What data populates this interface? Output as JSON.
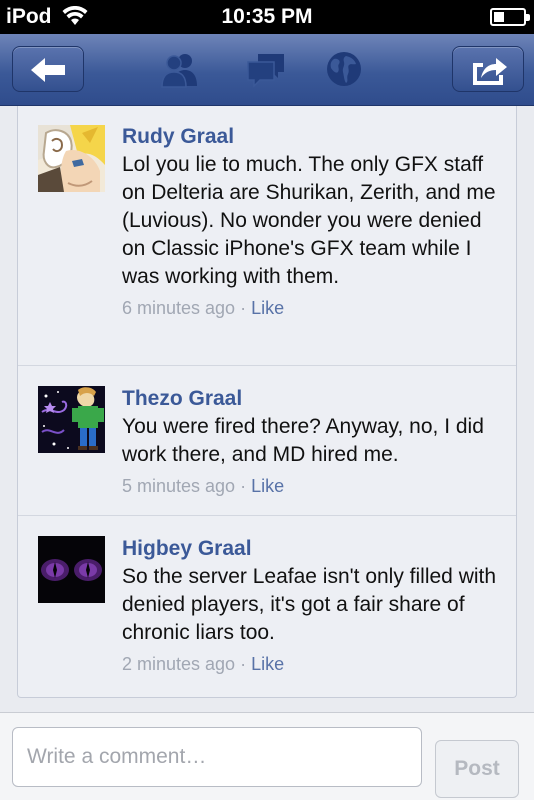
{
  "status_bar": {
    "carrier": "iPod",
    "time": "10:35 PM"
  },
  "nav": {
    "icons": [
      "back-arrow-icon",
      "friends-icon",
      "messages-icon",
      "globe-icon",
      "share-icon"
    ]
  },
  "comments": [
    {
      "author": "Rudy Graal",
      "text": "Lol you lie to much. The only GFX staff on Delteria are Shurikan, Zerith, and me (Luvious). No wonder you were denied on Classic iPhone's GFX team while I was working with them.",
      "time": "6 minutes ago",
      "separator": "·",
      "like": "Like"
    },
    {
      "author": "Thezo Graal",
      "text": "You were fired there? Anyway, no, I did work there, and MD hired me.",
      "time": "5 minutes ago",
      "separator": "·",
      "like": "Like"
    },
    {
      "author": "Higbey Graal",
      "text": "So the server Leafae isn't only filled with denied players, it's got a fair share of chronic liars too.",
      "time": "2 minutes ago",
      "separator": "·",
      "like": "Like"
    }
  ],
  "composer": {
    "placeholder": "Write a comment…",
    "value": "",
    "post_label": "Post"
  },
  "colors": {
    "nav_blue": "#3b5998",
    "author_blue": "#3b5998",
    "meta_gray": "#a1a7b3"
  }
}
